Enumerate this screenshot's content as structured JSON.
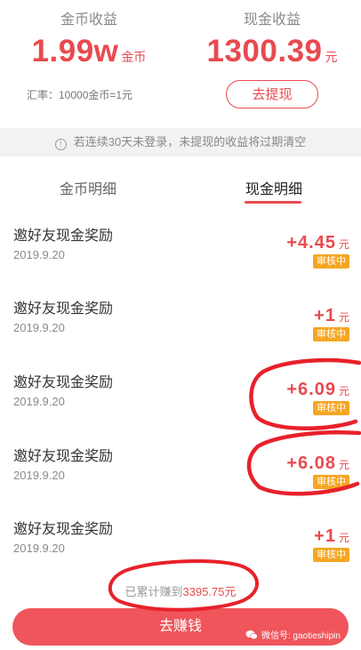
{
  "summary": {
    "coin": {
      "title": "金币收益",
      "amount": "1.99w",
      "unit": "金币",
      "rate": "汇率：10000金币=1元"
    },
    "cash": {
      "title": "现金收益",
      "amount": "1300.39",
      "unit": "元",
      "withdraw_label": "去提现"
    }
  },
  "notice": {
    "icon": "info-icon",
    "text": "若连续30天未登录，未提现的收益将过期清空"
  },
  "tabs": [
    {
      "label": "金币明细",
      "active": false
    },
    {
      "label": "现金明细",
      "active": true
    }
  ],
  "records": [
    {
      "title": "邀好友现金奖励",
      "date": "2019.9.20",
      "amount": "+4.45",
      "currency": "元",
      "status": "审核中"
    },
    {
      "title": "邀好友现金奖励",
      "date": "2019.9.20",
      "amount": "+1",
      "currency": "元",
      "status": "审核中"
    },
    {
      "title": "邀好友现金奖励",
      "date": "2019.9.20",
      "amount": "+6.09",
      "currency": "元",
      "status": "审核中"
    },
    {
      "title": "邀好友现金奖励",
      "date": "2019.9.20",
      "amount": "+6.08",
      "currency": "元",
      "status": "审核中"
    },
    {
      "title": "邀好友现金奖励",
      "date": "2019.9.20",
      "amount": "+1",
      "currency": "元",
      "status": "审核中"
    }
  ],
  "total": {
    "prefix": "已累计赚到",
    "value": "3395.75元"
  },
  "earn_button": "去赚钱",
  "watermark": {
    "icon": "wechat-icon",
    "text": "微信号: gaotieshipin"
  },
  "colors": {
    "accent": "#e84a4f",
    "badge": "#f5a623",
    "button": "#ef555b",
    "annotation": "#e8212b"
  }
}
